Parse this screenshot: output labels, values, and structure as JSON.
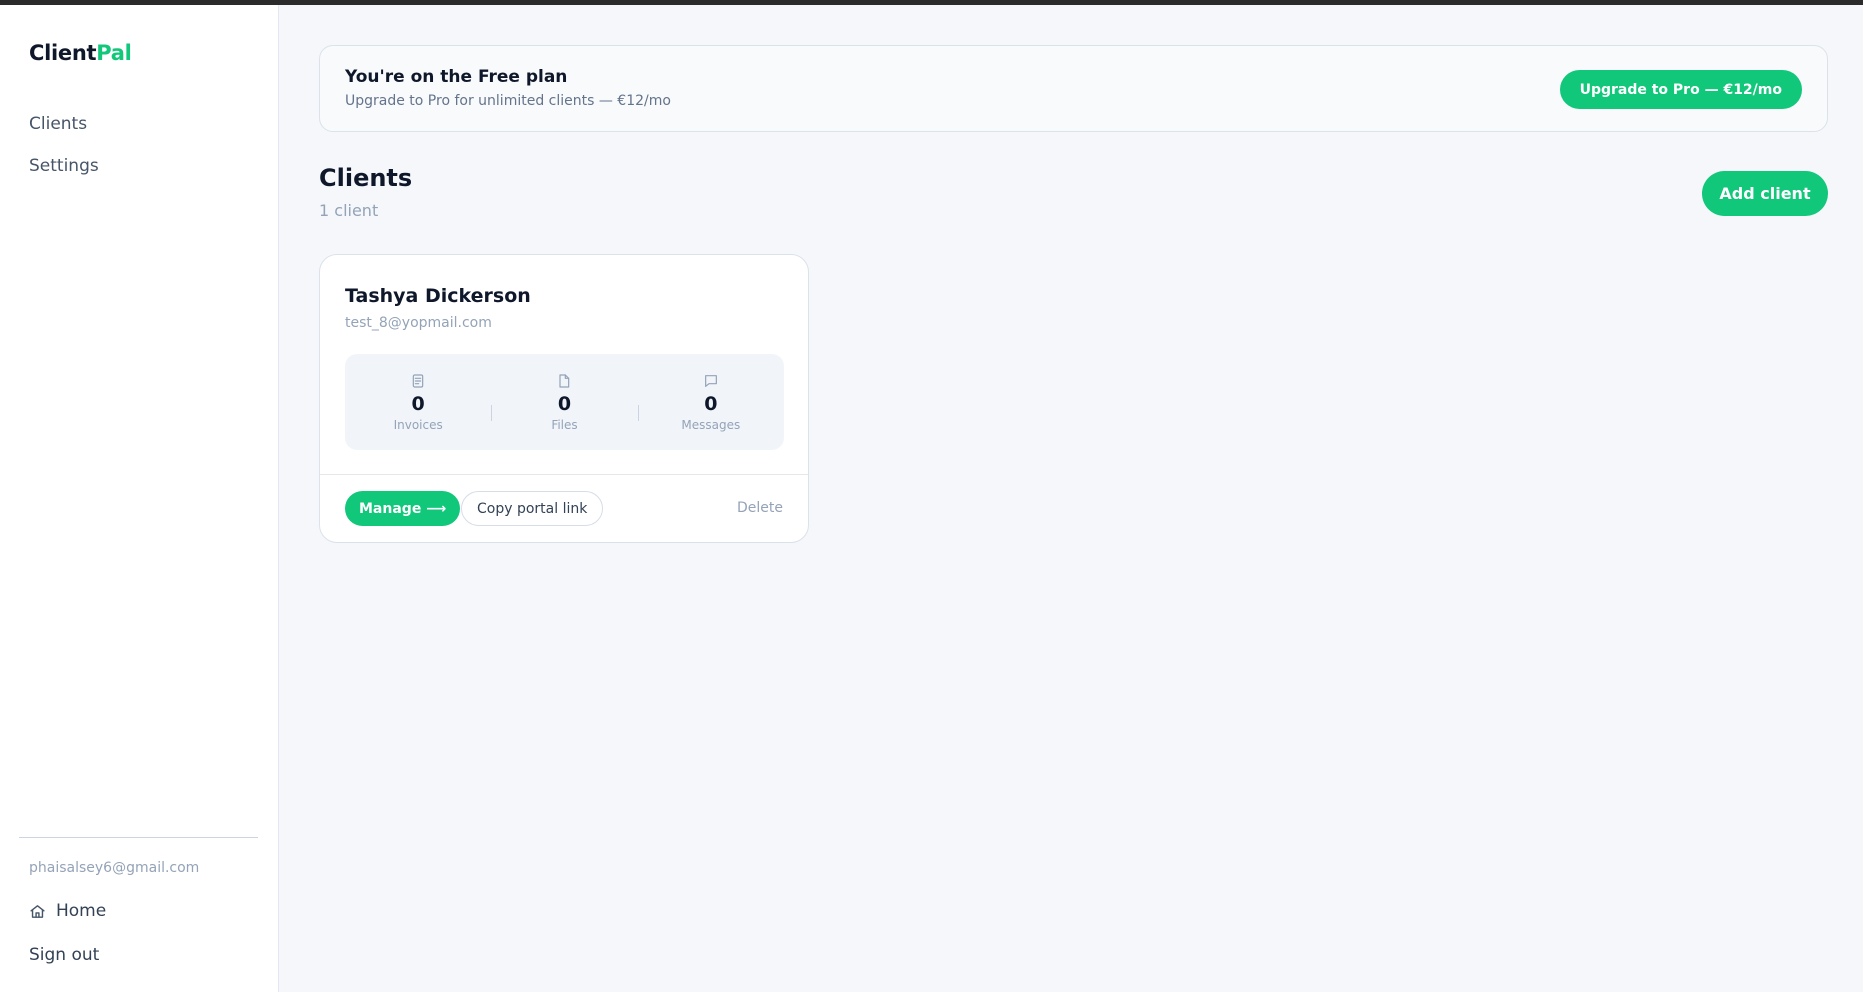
{
  "sidebar": {
    "brand_prefix": "Client",
    "brand_accent": "Pal",
    "nav": [
      {
        "label": "Clients"
      },
      {
        "label": "Settings"
      }
    ],
    "user_email": "phaisalsey6@gmail.com",
    "home_label": "Home",
    "signout_label": "Sign out"
  },
  "banner": {
    "title": "You're on the Free plan",
    "subtitle": "Upgrade to Pro for unlimited clients — €12/mo",
    "upgrade_label": "Upgrade to Pro — €12/mo"
  },
  "main": {
    "title": "Clients",
    "count": "1 client",
    "add_label": "Add client"
  },
  "clients": [
    {
      "name": "Tashya Dickerson",
      "email": "test_8@yopmail.com",
      "stats": [
        {
          "icon": "invoice-icon",
          "value": "0",
          "label": "Invoices"
        },
        {
          "icon": "file-icon",
          "value": "0",
          "label": "Files"
        },
        {
          "icon": "message-icon",
          "value": "0",
          "label": "Messages"
        }
      ],
      "manage_label": "Manage ⟶",
      "copy_label": "Copy portal link",
      "delete_label": "Delete"
    }
  ],
  "colors": {
    "accent": "#10c77a",
    "background": "#f5f7fb",
    "text": "#0f172a",
    "muted": "#94a3b8"
  }
}
